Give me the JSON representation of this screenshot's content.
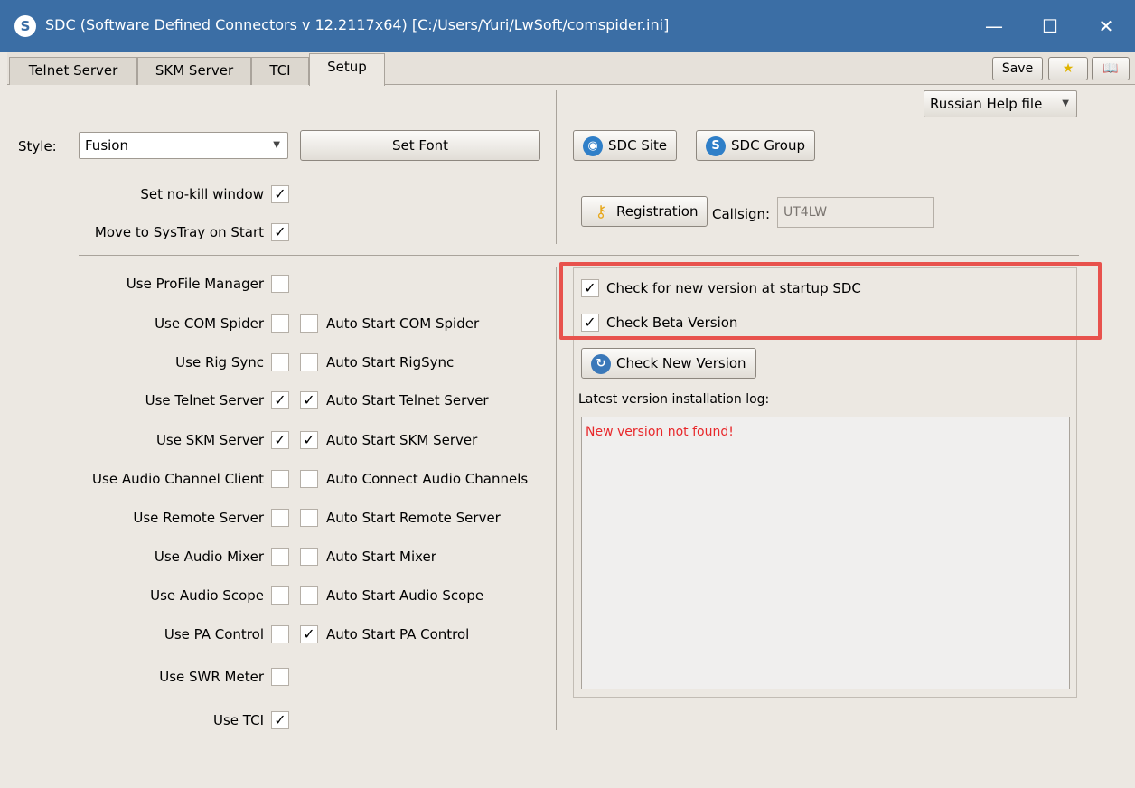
{
  "window": {
    "title": "SDC (Software Defined Connectors v 12.2117x64) [C:/Users/Yuri/LwSoft/comspider.ini]",
    "app_icon": "S",
    "controls": {
      "minimize": "—",
      "maximize": "☐",
      "close": "✕"
    }
  },
  "tabs": [
    "Telnet Server",
    "SKM Server",
    "TCI",
    "Setup"
  ],
  "toolbar": {
    "save_label": "Save",
    "star_icon": "★",
    "book_icon": "📖"
  },
  "left": {
    "style_label": "Style:",
    "style_value": "Fusion",
    "set_font_label": "Set Font",
    "no_kill_label": "Set no-kill window",
    "no_kill_checked": "✓",
    "systray_label": "Move to SysTray on Start",
    "systray_checked": "✓",
    "rows": [
      {
        "use_label": "Use ProFile Manager",
        "use_check": "",
        "auto_label": "",
        "auto_check": ""
      },
      {
        "use_label": "Use COM Spider",
        "use_check": "",
        "auto_label": "Auto Start COM Spider",
        "auto_check": ""
      },
      {
        "use_label": "Use Rig Sync",
        "use_check": "",
        "auto_label": "Auto Start RigSync",
        "auto_check": ""
      },
      {
        "use_label": "Use Telnet Server",
        "use_check": "✓",
        "auto_label": "Auto Start Telnet Server",
        "auto_check": "✓"
      },
      {
        "use_label": "Use SKM Server",
        "use_check": "✓",
        "auto_label": "Auto Start SKM Server",
        "auto_check": "✓"
      },
      {
        "use_label": "Use Audio Channel Client",
        "use_check": "",
        "auto_label": "Auto Connect Audio Channels",
        "auto_check": ""
      },
      {
        "use_label": "Use Remote Server",
        "use_check": "",
        "auto_label": "Auto Start Remote Server",
        "auto_check": ""
      },
      {
        "use_label": "Use Audio Mixer",
        "use_check": "",
        "auto_label": "Auto Start Mixer",
        "auto_check": ""
      },
      {
        "use_label": "Use Audio Scope",
        "use_check": "",
        "auto_label": "Auto Start Audio Scope",
        "auto_check": ""
      },
      {
        "use_label": "Use PA Control",
        "use_check": "",
        "auto_label": "Auto Start PA Control",
        "auto_check": "✓"
      },
      {
        "use_label": "Use SWR Meter",
        "use_check": "",
        "auto_label": "",
        "auto_check": ""
      },
      {
        "use_label": "Use TCI",
        "use_check": "✓",
        "auto_label": "",
        "auto_check": ""
      }
    ]
  },
  "right": {
    "help_file": "Russian Help file",
    "sdc_site": "SDC Site",
    "sdc_group": "SDC Group",
    "registration": "Registration",
    "callsign_label": "Callsign:",
    "callsign_value": "UT4LW",
    "check_startup_label": "Check for new version at startup SDC",
    "check_startup_checked": "✓",
    "check_beta_label": "Check Beta Version",
    "check_beta_checked": "✓",
    "check_new_version": "Check New Version",
    "log_label": "Latest version installation log:",
    "log_text": "New version not found!",
    "log_text_color": "#e8282b"
  }
}
